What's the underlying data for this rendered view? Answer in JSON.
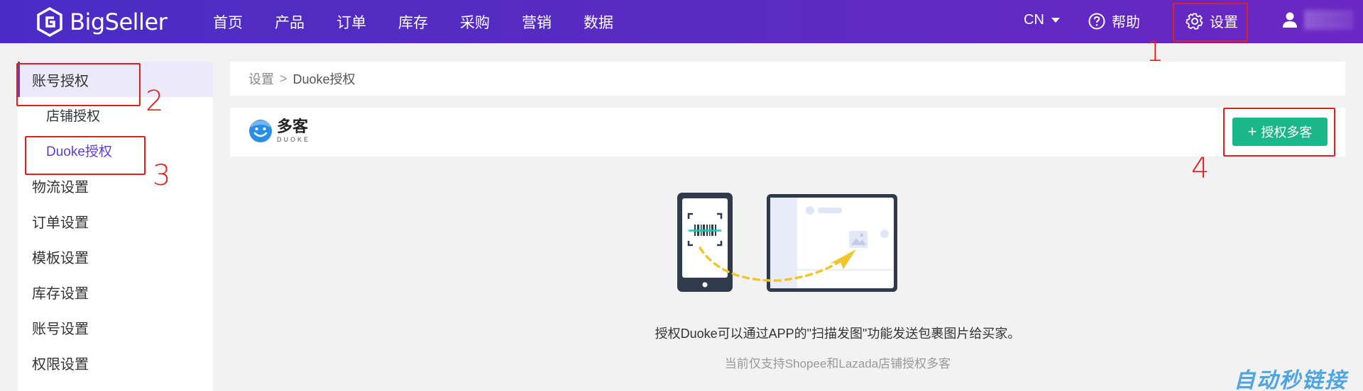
{
  "header": {
    "brand": "BigSeller",
    "nav": [
      "首页",
      "产品",
      "订单",
      "库存",
      "采购",
      "营销",
      "数据"
    ],
    "lang": "CN",
    "help": "帮助",
    "settings": "设置"
  },
  "sidebar": {
    "items": [
      {
        "label": "账号授权"
      },
      {
        "label": "店铺授权"
      },
      {
        "label": "Duoke授权"
      },
      {
        "label": "物流设置"
      },
      {
        "label": "订单设置"
      },
      {
        "label": "模板设置"
      },
      {
        "label": "库存设置"
      },
      {
        "label": "账号设置"
      },
      {
        "label": "权限设置"
      }
    ]
  },
  "breadcrumb": {
    "root": "设置",
    "separator": ">",
    "current": "Duoke授权"
  },
  "duoke": {
    "name_cn": "多客",
    "name_en": "DUOKE"
  },
  "auth_button": {
    "plus": "+",
    "label": "授权多客"
  },
  "description": {
    "main": "授权Duoke可以通过APP的\"扫描发图\"功能发送包裹图片给买家。",
    "sub": "当前仅支持Shopee和Lazada店铺授权多客"
  },
  "annotations": [
    "1",
    "2",
    "3",
    "4"
  ],
  "watermark": "自动秒链接",
  "colors": {
    "header_start": "#4a2cc4",
    "header_end": "#6a27c4",
    "accent": "#5b3fd4",
    "button": "#1bb78a",
    "annotation": "#e0201c"
  }
}
